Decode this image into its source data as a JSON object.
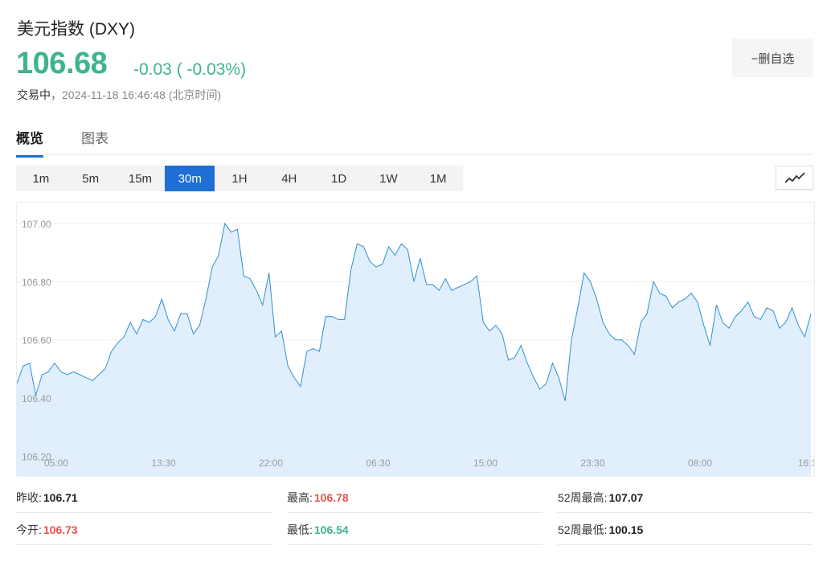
{
  "header": {
    "title": "美元指数 (DXY)",
    "price": "106.68",
    "change": "-0.03 ( -0.03%)",
    "status_label": "交易中",
    "status_time": "2024-11-18 16:46:48",
    "status_tz": "(北京时间)",
    "watch_label": "−删自选"
  },
  "tabs": [
    {
      "label": "概览",
      "active": true
    },
    {
      "label": "图表",
      "active": false
    }
  ],
  "intervals": [
    "1m",
    "5m",
    "15m",
    "30m",
    "1H",
    "4H",
    "1D",
    "1W",
    "1M"
  ],
  "active_interval": "30m",
  "chart_type_icon": "line-chart-icon",
  "colors": {
    "up": "#e5534b",
    "down": "#3eb489",
    "accent": "#1e6fd6",
    "line": "#2f8fd1",
    "fill": "#e1effd"
  },
  "chart_data": {
    "type": "area",
    "x_ticks": [
      "05:00",
      "13:30",
      "22:00",
      "06:30",
      "15:00",
      "23:30",
      "08:00",
      "16:3"
    ],
    "y_ticks": [
      "107.00",
      "106.80",
      "106.60",
      "106.40",
      "106.20"
    ],
    "ylim": [
      106.2,
      107.1
    ],
    "grid": true,
    "values": [
      106.45,
      106.51,
      106.52,
      106.41,
      106.48,
      106.49,
      106.52,
      106.49,
      106.48,
      106.49,
      106.48,
      106.47,
      106.46,
      106.48,
      106.5,
      106.56,
      106.59,
      106.61,
      106.66,
      106.62,
      106.67,
      106.66,
      106.68,
      106.74,
      106.67,
      106.63,
      106.69,
      106.69,
      106.62,
      106.65,
      106.74,
      106.85,
      106.89,
      107.0,
      106.97,
      106.98,
      106.82,
      106.81,
      106.77,
      106.72,
      106.83,
      106.61,
      106.63,
      106.51,
      106.47,
      106.44,
      106.56,
      106.57,
      106.56,
      106.68,
      106.68,
      106.67,
      106.67,
      106.84,
      106.93,
      106.92,
      106.87,
      106.85,
      106.86,
      106.92,
      106.89,
      106.93,
      106.91,
      106.8,
      106.88,
      106.79,
      106.79,
      106.77,
      106.81,
      106.77,
      106.78,
      106.79,
      106.8,
      106.82,
      106.66,
      106.63,
      106.65,
      106.62,
      106.53,
      106.54,
      106.58,
      106.52,
      106.47,
      106.43,
      106.45,
      106.52,
      106.47,
      106.39,
      106.6,
      106.71,
      106.83,
      106.8,
      106.74,
      106.66,
      106.62,
      106.6,
      106.6,
      106.58,
      106.55,
      106.66,
      106.69,
      106.8,
      106.76,
      106.75,
      106.71,
      106.73,
      106.74,
      106.76,
      106.73,
      106.65,
      106.58,
      106.72,
      106.66,
      106.64,
      106.68,
      106.7,
      106.73,
      106.68,
      106.67,
      106.71,
      106.7,
      106.64,
      106.66,
      106.71,
      106.65,
      106.61,
      106.69
    ]
  },
  "stats": {
    "prev_close_label": "昨收:",
    "prev_close": "106.71",
    "open_label": "今开:",
    "open": "106.73",
    "high_label": "最高:",
    "high": "106.78",
    "low_label": "最低:",
    "low": "106.54",
    "high52_label": "52周最高:",
    "high52": "107.07",
    "low52_label": "52周最低:",
    "low52": "100.15"
  }
}
